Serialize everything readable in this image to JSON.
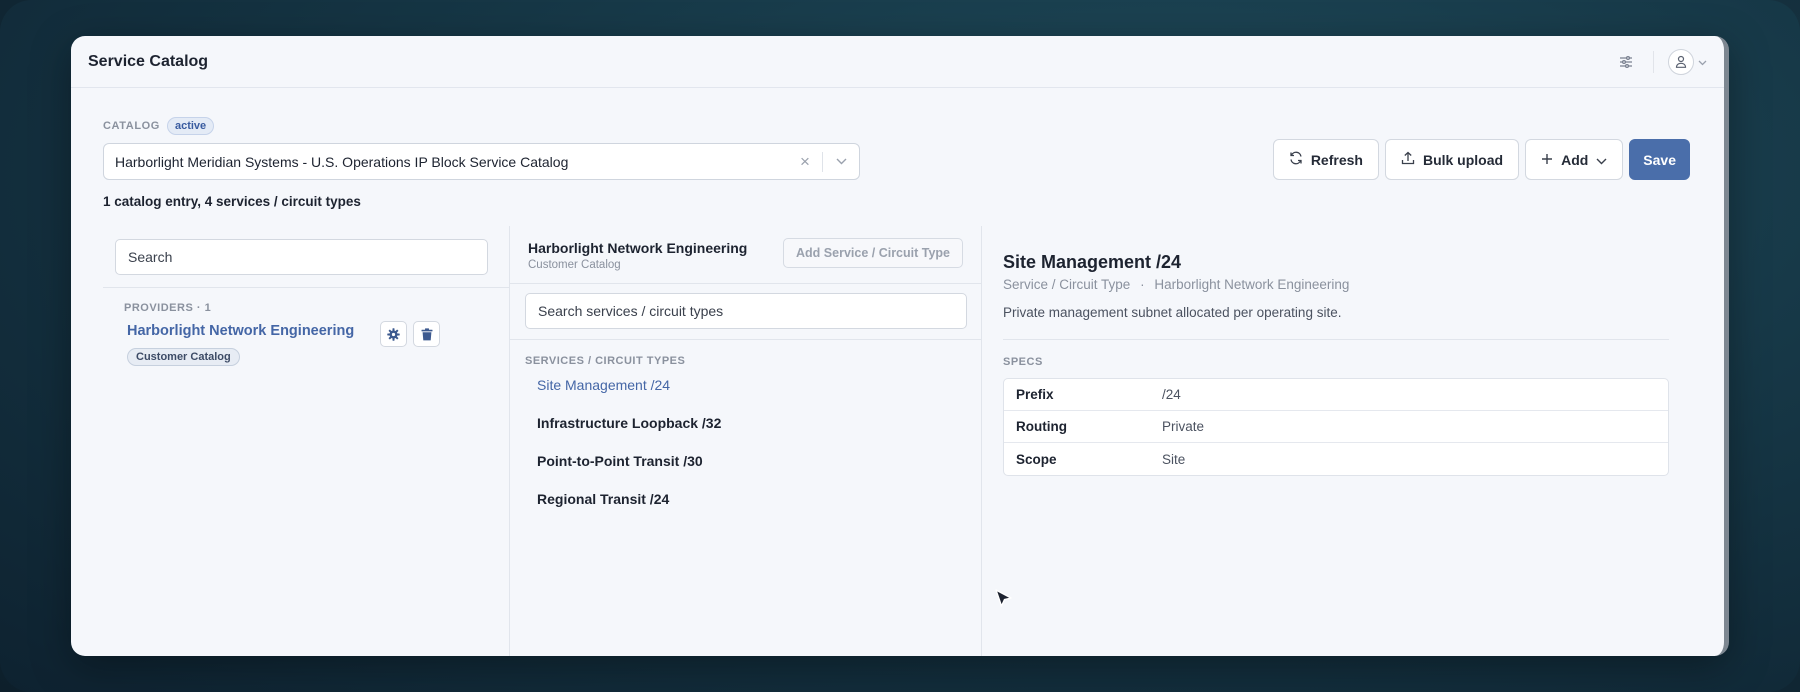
{
  "app": {
    "title": "Service Catalog"
  },
  "catalog": {
    "label": "CATALOG",
    "status": "active",
    "selected": "Harborlight Meridian Systems - U.S. Operations IP Block Service Catalog",
    "summary": "1 catalog entry, 4 services / circuit types"
  },
  "toolbar": {
    "refresh": "Refresh",
    "bulk_upload": "Bulk upload",
    "add": "Add",
    "save": "Save"
  },
  "providers": {
    "search_placeholder": "Search",
    "header": "PROVIDERS · 1",
    "items": [
      {
        "name": "Harborlight Network Engineering",
        "badge": "Customer Catalog"
      }
    ]
  },
  "services": {
    "provider_name": "Harborlight Network Engineering",
    "provider_sub": "Customer Catalog",
    "add_button": "Add Service / Circuit Type",
    "search_placeholder": "Search services / circuit types",
    "header": "SERVICES / CIRCUIT TYPES",
    "items": [
      "Site Management /24",
      "Infrastructure Loopback /32",
      "Point-to-Point Transit /30",
      "Regional Transit /24"
    ],
    "active_index": 0
  },
  "detail": {
    "title": "Site Management /24",
    "type": "Service / Circuit Type",
    "provider": "Harborlight Network Engineering",
    "separator": "·",
    "description": "Private management subnet allocated per operating site.",
    "specs_header": "SPECS",
    "specs": [
      {
        "key": "Prefix",
        "value": "/24"
      },
      {
        "key": "Routing",
        "value": "Private"
      },
      {
        "key": "Scope",
        "value": "Site"
      }
    ]
  },
  "colors": {
    "accent": "#4a6eaa",
    "link": "#4466a6"
  }
}
